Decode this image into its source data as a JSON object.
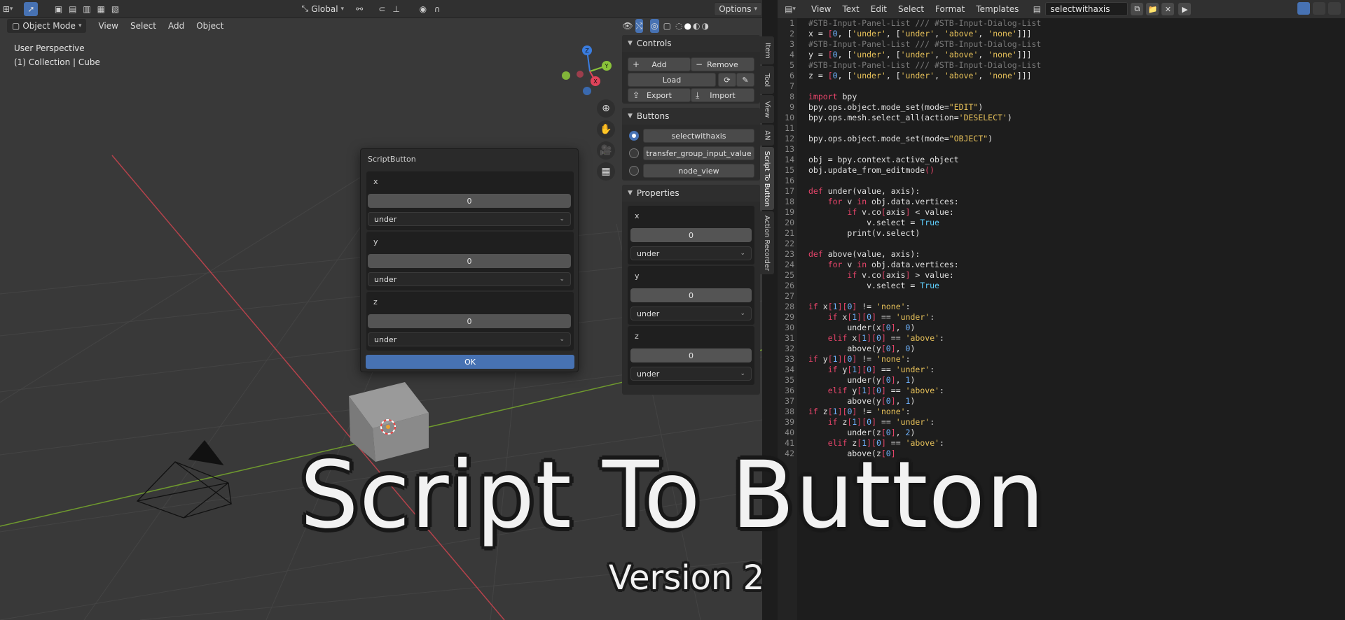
{
  "viewport": {
    "header": {
      "transform_orientation": "Global",
      "options_label": "Options"
    },
    "header2": {
      "mode_label": "Object Mode",
      "menu": [
        "View",
        "Select",
        "Add",
        "Object"
      ]
    },
    "info": {
      "perspective": "User Perspective",
      "collection": "(1) Collection | Cube"
    },
    "gizmo": {
      "z_label": "Z",
      "y_label": "Y",
      "x_label": "X"
    }
  },
  "dialog": {
    "title": "ScriptButton",
    "fields": [
      {
        "label": "x",
        "value": "0",
        "option": "under"
      },
      {
        "label": "y",
        "value": "0",
        "option": "under"
      },
      {
        "label": "z",
        "value": "0",
        "option": "under"
      }
    ],
    "ok_label": "OK"
  },
  "npanel": {
    "controls": {
      "title": "Controls",
      "add_label": "Add",
      "remove_label": "Remove",
      "load_label": "Load",
      "export_label": "Export",
      "import_label": "Import"
    },
    "buttons": {
      "title": "Buttons",
      "items": [
        {
          "label": "selectwithaxis",
          "selected": true
        },
        {
          "label": "transfer_group_input_value",
          "selected": false
        },
        {
          "label": "node_view",
          "selected": false
        }
      ]
    },
    "properties": {
      "title": "Properties",
      "fields": [
        {
          "label": "x",
          "value": "0",
          "option": "under"
        },
        {
          "label": "y",
          "value": "0",
          "option": "under"
        },
        {
          "label": "z",
          "value": "0",
          "option": "under"
        }
      ]
    },
    "tabs": [
      "Item",
      "Tool",
      "View",
      "AN",
      "Script To Button",
      "Action Recorder"
    ],
    "active_tab": "Script To Button"
  },
  "text_editor": {
    "menu": [
      "View",
      "Text",
      "Edit",
      "Select",
      "Format",
      "Templates"
    ],
    "text_name": "selectwithaxis",
    "lines": [
      [
        [
          "c",
          "#STB-Input-Panel-List /// #STB-Input-Dialog-List"
        ]
      ],
      [
        [
          "n",
          "x = "
        ],
        [
          "p",
          "["
        ],
        [
          "num",
          "0"
        ],
        [
          "n",
          ", ["
        ],
        [
          "s",
          "'under'"
        ],
        [
          "n",
          ", ["
        ],
        [
          "s",
          "'under'"
        ],
        [
          "n",
          ", "
        ],
        [
          "s",
          "'above'"
        ],
        [
          "n",
          ", "
        ],
        [
          "s",
          "'none'"
        ],
        [
          "n",
          "]]]"
        ]
      ],
      [
        [
          "c",
          "#STB-Input-Panel-List /// #STB-Input-Dialog-List"
        ]
      ],
      [
        [
          "n",
          "y = "
        ],
        [
          "p",
          "["
        ],
        [
          "num",
          "0"
        ],
        [
          "n",
          ", ["
        ],
        [
          "s",
          "'under'"
        ],
        [
          "n",
          ", ["
        ],
        [
          "s",
          "'under'"
        ],
        [
          "n",
          ", "
        ],
        [
          "s",
          "'above'"
        ],
        [
          "n",
          ", "
        ],
        [
          "s",
          "'none'"
        ],
        [
          "n",
          "]]]"
        ]
      ],
      [
        [
          "c",
          "#STB-Input-Panel-List /// #STB-Input-Dialog-List"
        ]
      ],
      [
        [
          "n",
          "z = "
        ],
        [
          "p",
          "["
        ],
        [
          "num",
          "0"
        ],
        [
          "n",
          ", ["
        ],
        [
          "s",
          "'under'"
        ],
        [
          "n",
          ", ["
        ],
        [
          "s",
          "'under'"
        ],
        [
          "n",
          ", "
        ],
        [
          "s",
          "'above'"
        ],
        [
          "n",
          ", "
        ],
        [
          "s",
          "'none'"
        ],
        [
          "n",
          "]]]"
        ]
      ],
      [],
      [
        [
          "k",
          "import"
        ],
        [
          "n",
          " bpy"
        ]
      ],
      [
        [
          "n",
          "bpy.ops.object.mode_set(mode="
        ],
        [
          "s",
          "\"EDIT\""
        ],
        [
          "n",
          ")"
        ]
      ],
      [
        [
          "n",
          "bpy.ops.mesh.select_all(action="
        ],
        [
          "s",
          "'DESELECT'"
        ],
        [
          "n",
          ")"
        ]
      ],
      [],
      [
        [
          "n",
          "bpy.ops.object.mode_set(mode="
        ],
        [
          "s",
          "\"OBJECT\""
        ],
        [
          "n",
          ")"
        ]
      ],
      [],
      [
        [
          "n",
          "obj = bpy.context.active_object"
        ]
      ],
      [
        [
          "n",
          "obj.update_from_editmode"
        ],
        [
          "k",
          "()"
        ]
      ],
      [],
      [
        [
          "k",
          "def"
        ],
        [
          "n",
          " under(value, axis):"
        ]
      ],
      [
        [
          "n",
          "    "
        ],
        [
          "k",
          "for"
        ],
        [
          "n",
          " v "
        ],
        [
          "k",
          "in"
        ],
        [
          "n",
          " obj.data.vertices:"
        ]
      ],
      [
        [
          "n",
          "        "
        ],
        [
          "k",
          "if"
        ],
        [
          "n",
          " v.co"
        ],
        [
          "k",
          "["
        ],
        [
          "n",
          "axis"
        ],
        [
          "k",
          "]"
        ],
        [
          "n",
          " < value:"
        ]
      ],
      [
        [
          "n",
          "            v.select = "
        ],
        [
          "b",
          "True"
        ]
      ],
      [
        [
          "n",
          "        print(v.select)"
        ]
      ],
      [],
      [
        [
          "k",
          "def"
        ],
        [
          "n",
          " above(value, axis):"
        ]
      ],
      [
        [
          "n",
          "    "
        ],
        [
          "k",
          "for"
        ],
        [
          "n",
          " v "
        ],
        [
          "k",
          "in"
        ],
        [
          "n",
          " obj.data.vertices:"
        ]
      ],
      [
        [
          "n",
          "        "
        ],
        [
          "k",
          "if"
        ],
        [
          "n",
          " v.co"
        ],
        [
          "k",
          "["
        ],
        [
          "n",
          "axis"
        ],
        [
          "k",
          "]"
        ],
        [
          "n",
          " > value:"
        ]
      ],
      [
        [
          "n",
          "            v.select = "
        ],
        [
          "b",
          "True"
        ]
      ],
      [],
      [
        [
          "k",
          "if"
        ],
        [
          "n",
          " x"
        ],
        [
          "k",
          "["
        ],
        [
          "num",
          "1"
        ],
        [
          "k",
          "]["
        ],
        [
          "num",
          "0"
        ],
        [
          "k",
          "]"
        ],
        [
          "n",
          " != "
        ],
        [
          "s",
          "'none'"
        ],
        [
          "n",
          ":"
        ]
      ],
      [
        [
          "n",
          "    "
        ],
        [
          "k",
          "if"
        ],
        [
          "n",
          " x"
        ],
        [
          "k",
          "["
        ],
        [
          "num",
          "1"
        ],
        [
          "k",
          "]["
        ],
        [
          "num",
          "0"
        ],
        [
          "k",
          "]"
        ],
        [
          "n",
          " == "
        ],
        [
          "s",
          "'under'"
        ],
        [
          "n",
          ":"
        ]
      ],
      [
        [
          "n",
          "        under(x"
        ],
        [
          "k",
          "["
        ],
        [
          "num",
          "0"
        ],
        [
          "k",
          "]"
        ],
        [
          "n",
          ", "
        ],
        [
          "num",
          "0"
        ],
        [
          "n",
          ")"
        ]
      ],
      [
        [
          "n",
          "    "
        ],
        [
          "k",
          "elif"
        ],
        [
          "n",
          " x"
        ],
        [
          "k",
          "["
        ],
        [
          "num",
          "1"
        ],
        [
          "k",
          "]["
        ],
        [
          "num",
          "0"
        ],
        [
          "k",
          "]"
        ],
        [
          "n",
          " == "
        ],
        [
          "s",
          "'above'"
        ],
        [
          "n",
          ":"
        ]
      ],
      [
        [
          "n",
          "        above(y"
        ],
        [
          "k",
          "["
        ],
        [
          "num",
          "0"
        ],
        [
          "k",
          "]"
        ],
        [
          "n",
          ", "
        ],
        [
          "num",
          "0"
        ],
        [
          "n",
          ")"
        ]
      ],
      [
        [
          "k",
          "if"
        ],
        [
          "n",
          " y"
        ],
        [
          "k",
          "["
        ],
        [
          "num",
          "1"
        ],
        [
          "k",
          "]["
        ],
        [
          "num",
          "0"
        ],
        [
          "k",
          "]"
        ],
        [
          "n",
          " != "
        ],
        [
          "s",
          "'none'"
        ],
        [
          "n",
          ":"
        ]
      ],
      [
        [
          "n",
          "    "
        ],
        [
          "k",
          "if"
        ],
        [
          "n",
          " y"
        ],
        [
          "k",
          "["
        ],
        [
          "num",
          "1"
        ],
        [
          "k",
          "]["
        ],
        [
          "num",
          "0"
        ],
        [
          "k",
          "]"
        ],
        [
          "n",
          " == "
        ],
        [
          "s",
          "'under'"
        ],
        [
          "n",
          ":"
        ]
      ],
      [
        [
          "n",
          "        under(y"
        ],
        [
          "k",
          "["
        ],
        [
          "num",
          "0"
        ],
        [
          "k",
          "]"
        ],
        [
          "n",
          ", "
        ],
        [
          "num",
          "1"
        ],
        [
          "n",
          ")"
        ]
      ],
      [
        [
          "n",
          "    "
        ],
        [
          "k",
          "elif"
        ],
        [
          "n",
          " y"
        ],
        [
          "k",
          "["
        ],
        [
          "num",
          "1"
        ],
        [
          "k",
          "]["
        ],
        [
          "num",
          "0"
        ],
        [
          "k",
          "]"
        ],
        [
          "n",
          " == "
        ],
        [
          "s",
          "'above'"
        ],
        [
          "n",
          ":"
        ]
      ],
      [
        [
          "n",
          "        above(y"
        ],
        [
          "k",
          "["
        ],
        [
          "num",
          "0"
        ],
        [
          "k",
          "]"
        ],
        [
          "n",
          ", "
        ],
        [
          "num",
          "1"
        ],
        [
          "n",
          ")"
        ]
      ],
      [
        [
          "k",
          "if"
        ],
        [
          "n",
          " z"
        ],
        [
          "k",
          "["
        ],
        [
          "num",
          "1"
        ],
        [
          "k",
          "]["
        ],
        [
          "num",
          "0"
        ],
        [
          "k",
          "]"
        ],
        [
          "n",
          " != "
        ],
        [
          "s",
          "'none'"
        ],
        [
          "n",
          ":"
        ]
      ],
      [
        [
          "n",
          "    "
        ],
        [
          "k",
          "if"
        ],
        [
          "n",
          " z"
        ],
        [
          "k",
          "["
        ],
        [
          "num",
          "1"
        ],
        [
          "k",
          "]["
        ],
        [
          "num",
          "0"
        ],
        [
          "k",
          "]"
        ],
        [
          "n",
          " == "
        ],
        [
          "s",
          "'under'"
        ],
        [
          "n",
          ":"
        ]
      ],
      [
        [
          "n",
          "        under(z"
        ],
        [
          "k",
          "["
        ],
        [
          "num",
          "0"
        ],
        [
          "k",
          "]"
        ],
        [
          "n",
          ", "
        ],
        [
          "num",
          "2"
        ],
        [
          "n",
          ")"
        ]
      ],
      [
        [
          "n",
          "    "
        ],
        [
          "k",
          "elif"
        ],
        [
          "n",
          " z"
        ],
        [
          "k",
          "["
        ],
        [
          "num",
          "1"
        ],
        [
          "k",
          "]["
        ],
        [
          "num",
          "0"
        ],
        [
          "k",
          "]"
        ],
        [
          "n",
          " == "
        ],
        [
          "s",
          "'above'"
        ],
        [
          "n",
          ":"
        ]
      ],
      [
        [
          "n",
          "        above(z"
        ],
        [
          "k",
          "["
        ],
        [
          "num",
          "0"
        ],
        [
          "k",
          "]"
        ]
      ]
    ]
  },
  "overlay": {
    "title": "Script To Button",
    "subtitle": "Version 2"
  },
  "colors": {
    "accent": "#4772b3",
    "axis_x": "#e0435a",
    "axis_y": "#8ac33a",
    "axis_z": "#3a7de0"
  }
}
